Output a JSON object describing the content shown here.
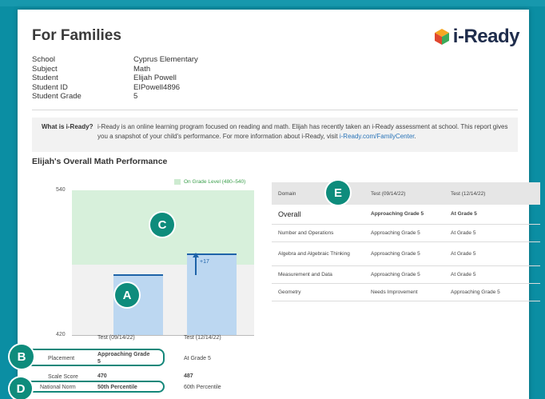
{
  "header": {
    "title": "For Families",
    "logo_text": "i-Ready"
  },
  "student_info": [
    {
      "label": "School",
      "value": "Cyprus Elementary"
    },
    {
      "label": "Subject",
      "value": "Math"
    },
    {
      "label": "Student",
      "value": "Elijah Powell"
    },
    {
      "label": "Student ID",
      "value": "EIPowell4896"
    },
    {
      "label": "Student Grade",
      "value": "5"
    }
  ],
  "whatis": {
    "label": "What is i-Ready?",
    "text": "i-Ready is an online learning program focused on reading and math. Elijah has recently taken an i-Ready assessment at school. This report gives you a snapshot of your child's performance. For more information about i-Ready, visit ",
    "link": "i-Ready.com/FamilyCenter",
    "after_link": "."
  },
  "performance_title": "Elijah's Overall Math Performance",
  "chart_data": {
    "type": "bar",
    "ylim": [
      420,
      540
    ],
    "y_ticks": [
      "540",
      "420"
    ],
    "legend": "On Grade Level (480–540)",
    "on_grade_range": [
      480,
      540
    ],
    "categories": [
      "Test (09/14/22)",
      "Test (12/14/22)"
    ],
    "values": [
      470,
      487
    ],
    "gain_label": "+17",
    "rows": [
      {
        "label": "Placement",
        "values": [
          "Approaching Grade 5",
          "At Grade 5"
        ]
      },
      {
        "label": "Scale Score",
        "values": [
          "470",
          "487"
        ]
      },
      {
        "label": "National Norm",
        "values": [
          "50th Percentile",
          "60th Percentile"
        ]
      }
    ]
  },
  "badges": [
    "A",
    "B",
    "C",
    "D",
    "E"
  ],
  "domain_table": {
    "headers": [
      "Domain",
      "Test (09/14/22)",
      "Test (12/14/22)"
    ],
    "rows": [
      [
        "Overall",
        "Approaching Grade 5",
        "At Grade 5"
      ],
      [
        "Number and Operations",
        "Approaching Grade 5",
        "At Grade 5"
      ],
      [
        "Algebra and Algebraic Thinking",
        "Approaching Grade 5",
        "At Grade 5"
      ],
      [
        "Measurement and Data",
        "Approaching Grade 5",
        "At Grade 5"
      ],
      [
        "Geometry",
        "Needs Improvement",
        "Approaching Grade 5"
      ]
    ]
  },
  "colors": {
    "on_grade_fill": "#d7f0db",
    "bar_fill": "#bcd7f1",
    "bar_line": "#1e63a8",
    "badge": "#0e8c7c",
    "link": "#2a74b8"
  }
}
